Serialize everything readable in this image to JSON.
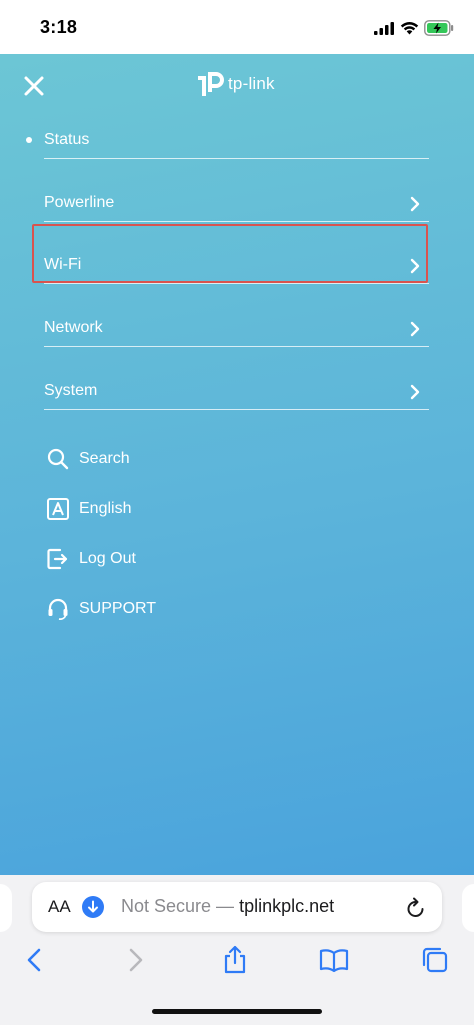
{
  "status_bar": {
    "time": "3:18"
  },
  "brand": {
    "logo_text": "tp-link"
  },
  "menu": {
    "items": [
      {
        "label": "Status"
      },
      {
        "label": "Powerline"
      },
      {
        "label": "Wi-Fi"
      },
      {
        "label": "Network"
      },
      {
        "label": "System"
      }
    ]
  },
  "utilities": {
    "items": [
      {
        "label": "Search",
        "icon": "search-icon"
      },
      {
        "label": "English",
        "icon": "language-icon"
      },
      {
        "label": "Log Out",
        "icon": "logout-icon"
      },
      {
        "label": "SUPPORT",
        "icon": "support-headset-icon"
      }
    ]
  },
  "browser": {
    "aa_label": "AA",
    "security_label": "Not Secure —",
    "host": "tplinkplc.net"
  },
  "colors": {
    "accent_highlight": "#d9534f",
    "toolbar_blue": "#2f7bf6"
  }
}
